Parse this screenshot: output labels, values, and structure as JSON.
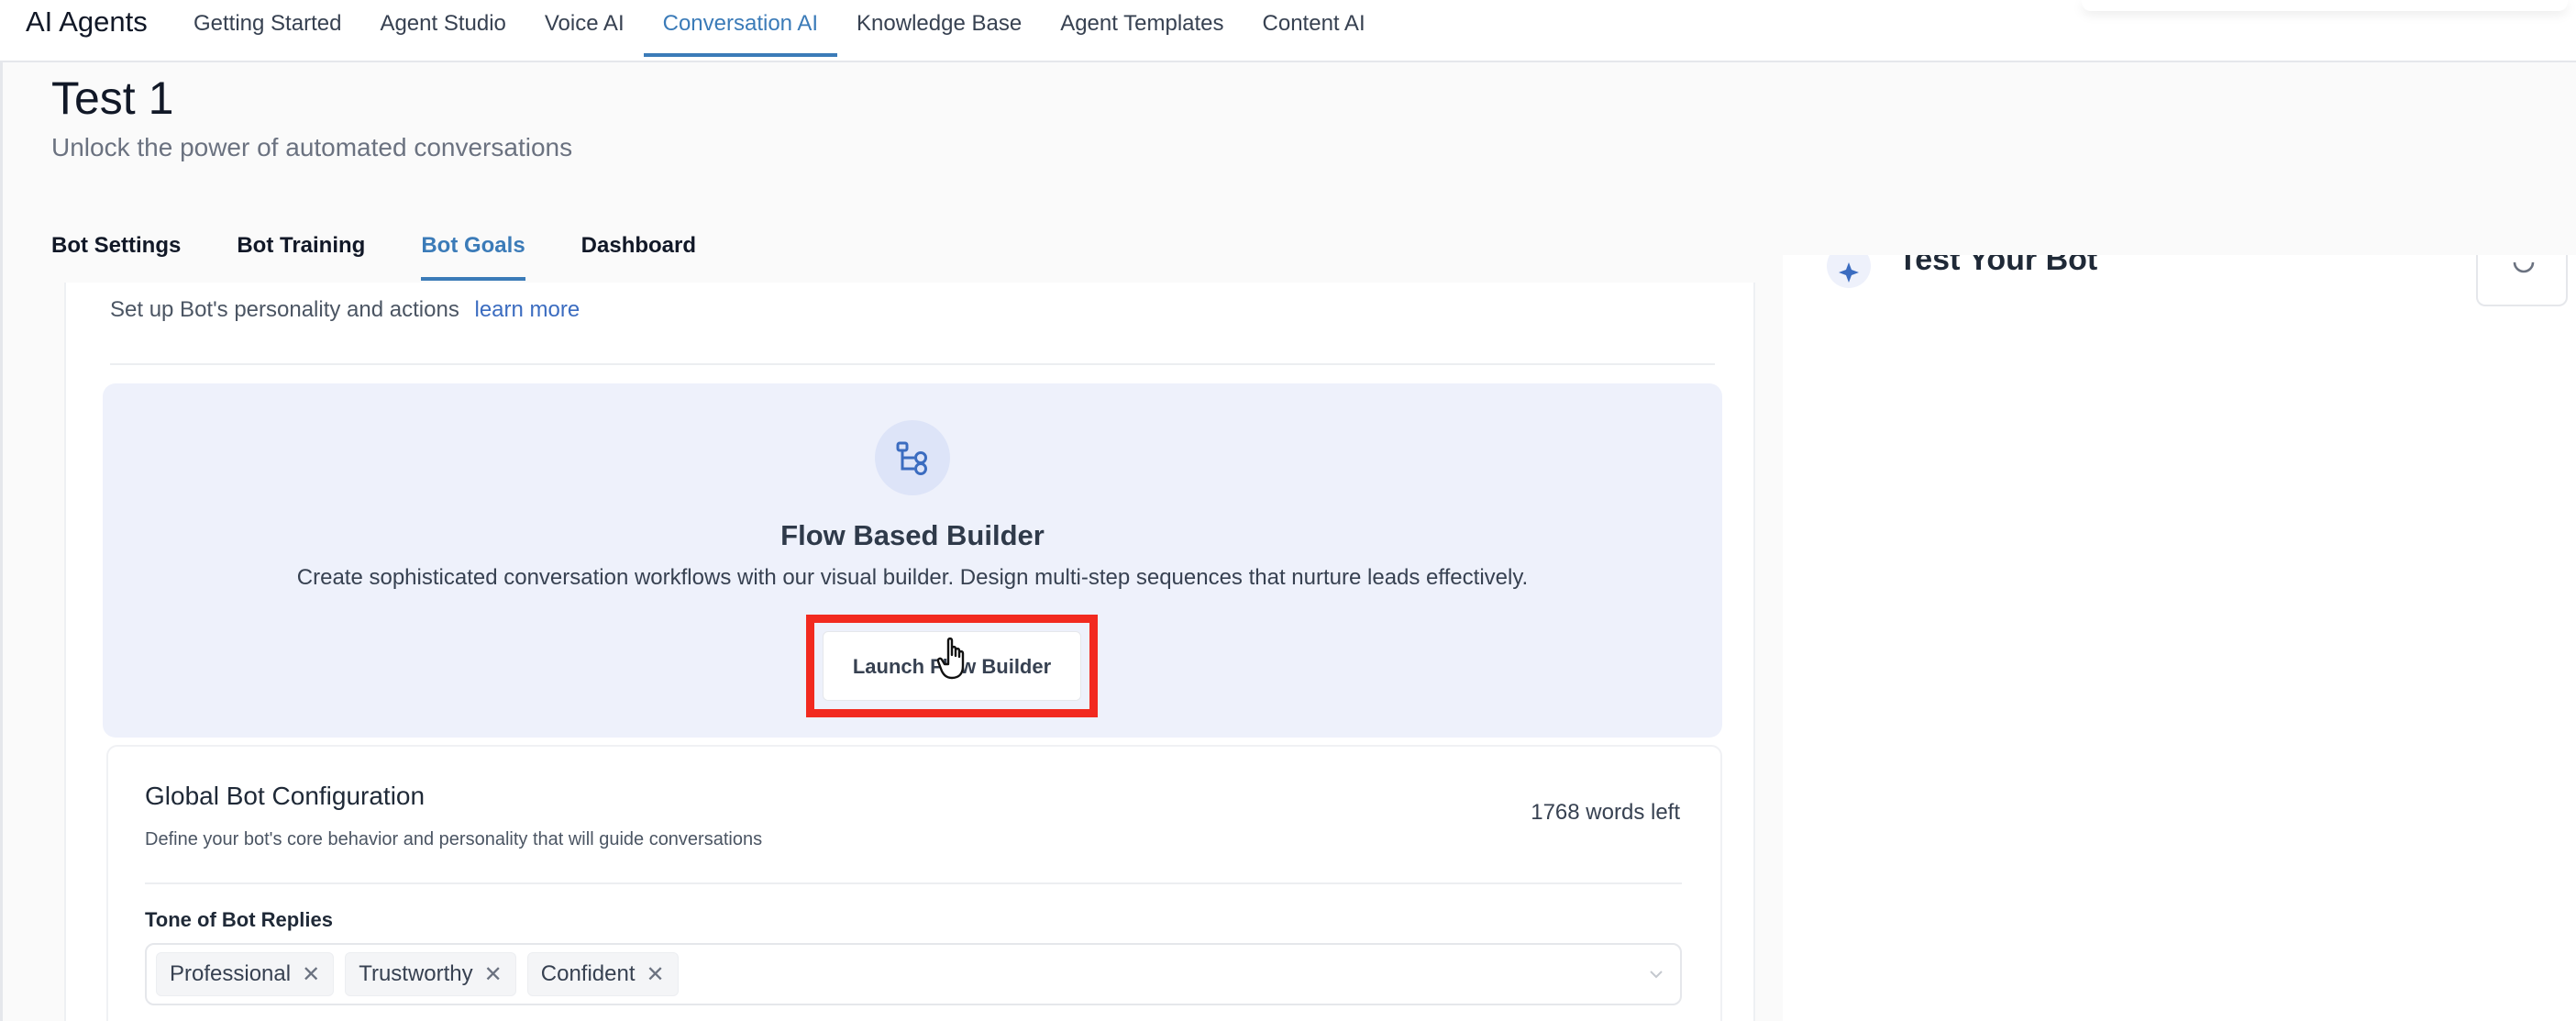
{
  "topnav": {
    "brand": "AI Agents",
    "tabs": [
      "Getting Started",
      "Agent Studio",
      "Voice AI",
      "Conversation AI",
      "Knowledge Base",
      "Agent Templates",
      "Content AI"
    ],
    "active_tab": "Conversation AI"
  },
  "header": {
    "title": "Test 1",
    "subtitle": "Unlock the power of automated conversations"
  },
  "subtabs": {
    "items": [
      "Bot Settings",
      "Bot Training",
      "Bot Goals",
      "Dashboard"
    ],
    "active": "Bot Goals"
  },
  "main": {
    "setup_text": "Set up Bot's personality and actions",
    "learn_more": "learn more",
    "flow_builder": {
      "icon": "flow-diagram-icon",
      "title": "Flow Based Builder",
      "description": "Create sophisticated conversation workflows with our visual builder. Design multi-step sequences that nurture leads effectively.",
      "button_label": "Launch Flow Builder",
      "highlight_color": "#f22a1f"
    },
    "global_config": {
      "title": "Global Bot Configuration",
      "description": "Define your bot's core behavior and personality that will guide conversations",
      "words_left": "1768 words left",
      "tone_label": "Tone of Bot Replies",
      "tones": [
        "Professional",
        "Trustworthy",
        "Confident"
      ]
    }
  },
  "right_panel": {
    "title": "Test Your Bot"
  },
  "colors": {
    "accent": "#3b7bb8",
    "link": "#3b6cc0",
    "panel_bg": "#eef1fb"
  }
}
